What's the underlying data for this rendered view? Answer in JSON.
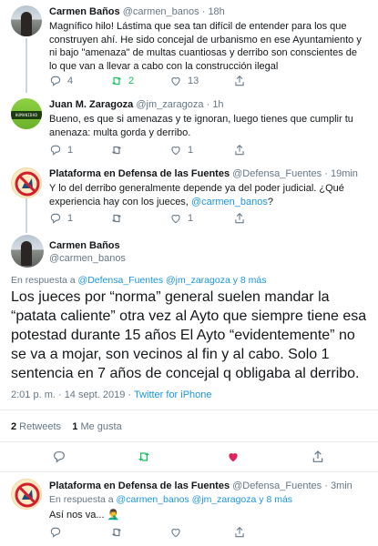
{
  "tweets": [
    {
      "name": "Carmen Baños",
      "handle": "@carmen_banos",
      "time": "18h",
      "text": "Magnífico hilo! Lástima que sea tan difícil de entender para los que construyen ahí. He sido concejal de urbanismo en ese Ayuntamiento y ni bajo \"amenaza\" de multas cuantiosas y derribo son conscientes de lo que van a llevar a cabo con la construcción ilegal",
      "replies": "4",
      "retweets": "2",
      "likes": "13"
    },
    {
      "name": "Juan M. Zaragoza",
      "handle": "@jm_zaragoza",
      "time": "1h",
      "avatar_text": "HUMANIDAD",
      "text": "Bueno, es que si amenazas y te ignoran, luego tienes que cumplir tu anenaza: multa gorda y derribo.",
      "replies": "1",
      "retweets": "",
      "likes": "1"
    },
    {
      "name": "Plataforma en Defensa de las Fuentes",
      "handle": "@Defensa_Fuentes",
      "time": "19min",
      "text_before": "Y lo del derribo generalmente depende ya del poder judicial. ¿Qué experiencia hay con los jueces, ",
      "mention": "@carmen_banos",
      "text_after": "?",
      "replies": "1",
      "retweets": "",
      "likes": "1"
    }
  ],
  "main": {
    "name": "Carmen Baños",
    "handle": "@carmen_banos",
    "reply_prefix": "En respuesta a ",
    "reply_mentions": "@Defensa_Fuentes @jm_zaragoza",
    "reply_more": " y 8 más",
    "text": "Los jueces por “norma” general suelen mandar la “patata caliente” otra vez al Ayto que siempre tiene esa potestad durante 15 años El Ayto “evidentemente” no se va a mojar, son vecinos al fin y al cabo. Solo 1 sentencia en 7 años de concejal q obligaba al derribo.",
    "datetime": "2:01 p. m. · 14 sept. 2019 · ",
    "source": "Twitter for iPhone",
    "retweet_count": "2",
    "retweet_label": " Retweets",
    "like_count": "1",
    "like_label": " Me gusta"
  },
  "reply": {
    "name": "Plataforma en Defensa de las Fuentes",
    "handle": "@Defensa_Fuentes",
    "time": "3min",
    "reply_prefix": "En respuesta a ",
    "reply_mentions": "@carmen_banos @jm_zaragoza",
    "reply_more": " y 8 más",
    "text": "Así nos va... 🤦‍♂️"
  },
  "colors": {
    "retweet_green": "#17bf63",
    "like_red": "#e0245e",
    "link_blue": "#1b95e0"
  }
}
